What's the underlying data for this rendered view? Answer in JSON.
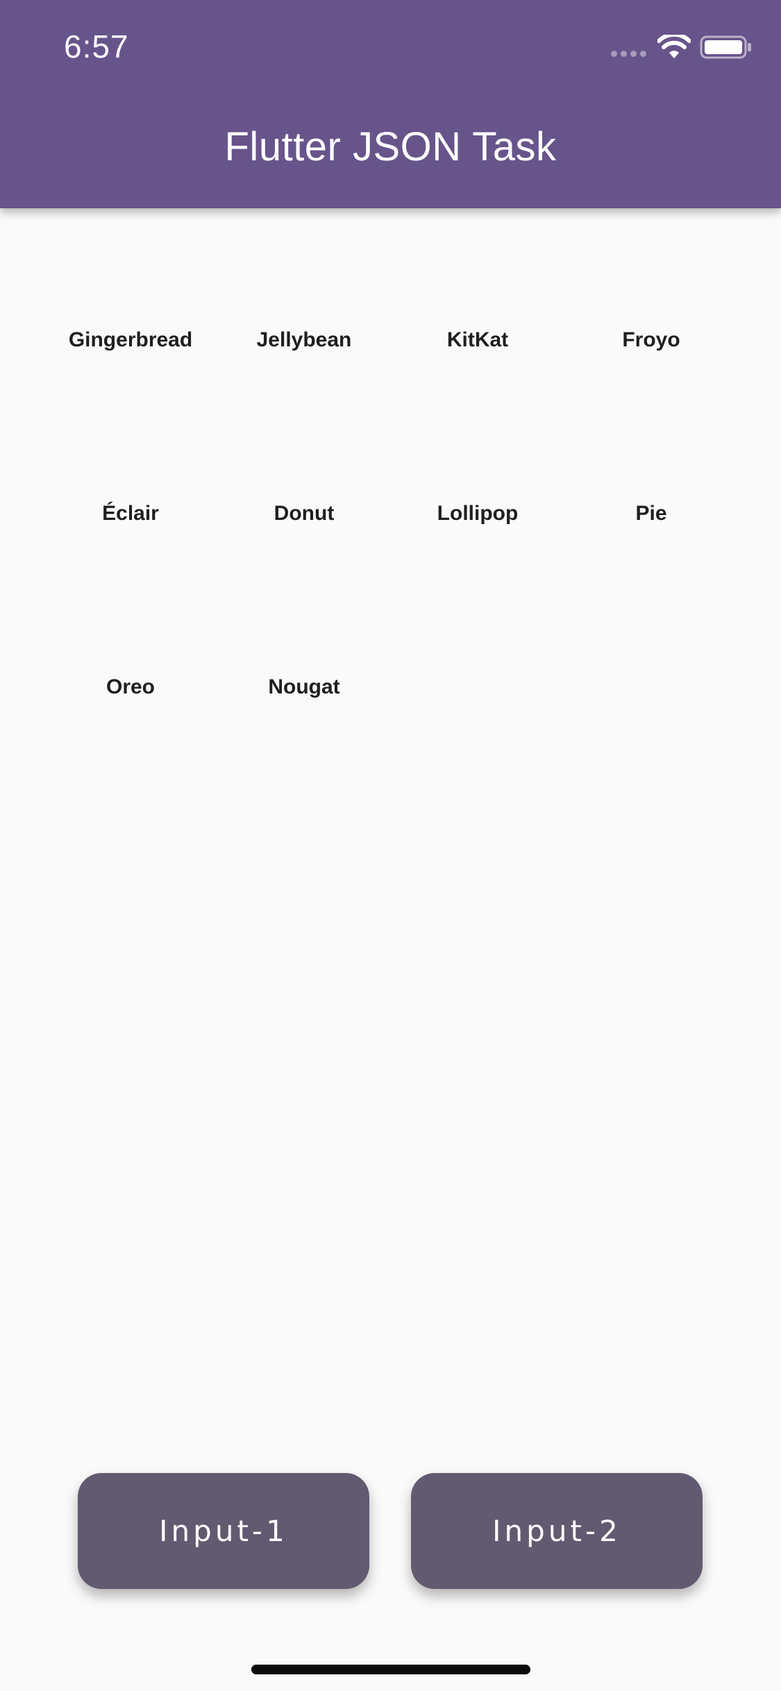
{
  "status_bar": {
    "time": "6:57",
    "icons": [
      "cellular-signal-icon",
      "wifi-icon",
      "battery-icon"
    ]
  },
  "app_bar": {
    "title": "Flutter JSON Task",
    "background_color": "#67548b"
  },
  "grid": {
    "items": [
      "Gingerbread",
      "Jellybean",
      "KitKat",
      "Froyo",
      "Éclair",
      "Donut",
      "Lollipop",
      "Pie",
      "Oreo",
      "Nougat"
    ]
  },
  "buttons": {
    "input_1": "Input-1",
    "input_2": "Input-2",
    "background_color": "#625a70"
  }
}
